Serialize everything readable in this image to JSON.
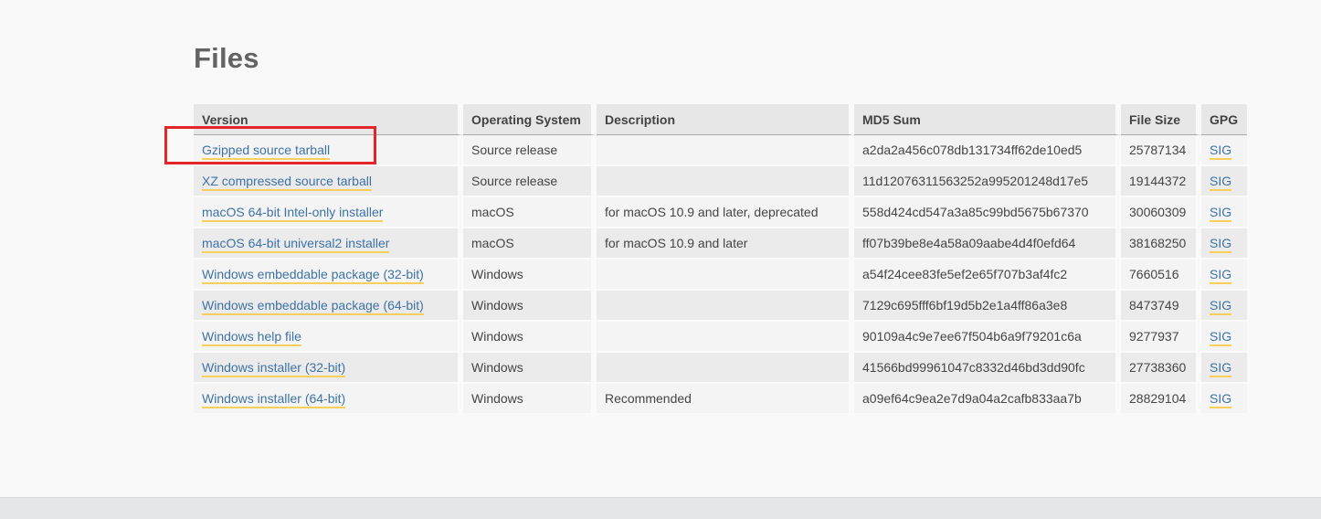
{
  "page": {
    "title": "Files"
  },
  "colors": {
    "highlight_red": "#e2262a",
    "link_blue": "#3d73a6",
    "link_underline_yellow": "#f7cf5a",
    "header_row_bg": "#e7e7e8",
    "row_odd_bg": "#f4f4f5",
    "row_even_bg": "#ebebec",
    "footer_bg": "#e5e6e8"
  },
  "annotation": {
    "highlighted_link": "Gzipped source tarball"
  },
  "table": {
    "headers": [
      "Version",
      "Operating System",
      "Description",
      "MD5 Sum",
      "File Size",
      "GPG"
    ],
    "rows": [
      {
        "version": "Gzipped source tarball",
        "os": "Source release",
        "description": "",
        "md5": "a2da2a456c078db131734ff62de10ed5",
        "size": "25787134",
        "gpg": "SIG"
      },
      {
        "version": "XZ compressed source tarball",
        "os": "Source release",
        "description": "",
        "md5": "11d12076311563252a995201248d17e5",
        "size": "19144372",
        "gpg": "SIG"
      },
      {
        "version": "macOS 64-bit Intel-only installer",
        "os": "macOS",
        "description": "for macOS 10.9 and later, deprecated",
        "md5": "558d424cd547a3a85c99bd5675b67370",
        "size": "30060309",
        "gpg": "SIG"
      },
      {
        "version": "macOS 64-bit universal2 installer",
        "os": "macOS",
        "description": "for macOS 10.9 and later",
        "md5": "ff07b39be8e4a58a09aabe4d4f0efd64",
        "size": "38168250",
        "gpg": "SIG"
      },
      {
        "version": "Windows embeddable package (32-bit)",
        "os": "Windows",
        "description": "",
        "md5": "a54f24cee83fe5ef2e65f707b3af4fc2",
        "size": "7660516",
        "gpg": "SIG"
      },
      {
        "version": "Windows embeddable package (64-bit)",
        "os": "Windows",
        "description": "",
        "md5": "7129c695fff6bf19d5b2e1a4ff86a3e8",
        "size": "8473749",
        "gpg": "SIG"
      },
      {
        "version": "Windows help file",
        "os": "Windows",
        "description": "",
        "md5": "90109a4c9e7ee67f504b6a9f79201c6a",
        "size": "9277937",
        "gpg": "SIG"
      },
      {
        "version": "Windows installer (32-bit)",
        "os": "Windows",
        "description": "",
        "md5": "41566bd99961047c8332d46bd3dd90fc",
        "size": "27738360",
        "gpg": "SIG"
      },
      {
        "version": "Windows installer (64-bit)",
        "os": "Windows",
        "description": "Recommended",
        "md5": "a09ef64c9ea2e7d9a04a2cafb833aa7b",
        "size": "28829104",
        "gpg": "SIG"
      }
    ]
  }
}
